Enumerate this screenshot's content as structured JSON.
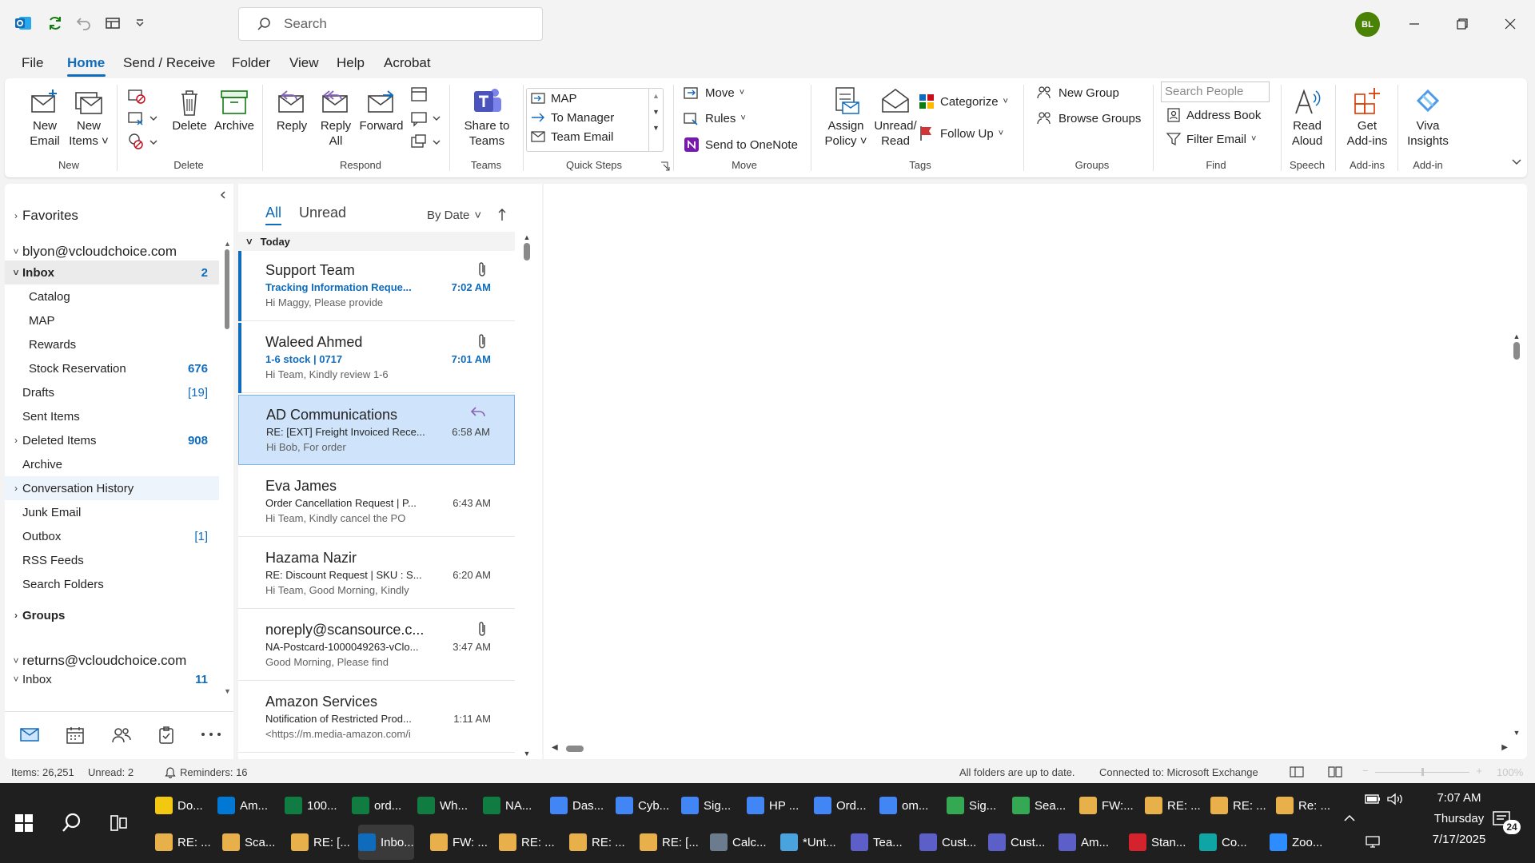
{
  "titlebar": {
    "search_placeholder": "Search",
    "avatar_initials": "BL"
  },
  "menu": [
    "File",
    "Home",
    "Send / Receive",
    "Folder",
    "View",
    "Help",
    "Acrobat"
  ],
  "ribbon": {
    "new_email": [
      "New",
      "Email"
    ],
    "new_items": [
      "New",
      "Items"
    ],
    "delete": "Delete",
    "archive": "Archive",
    "reply": "Reply",
    "reply_all": [
      "Reply",
      "All"
    ],
    "forward": "Forward",
    "share_to_teams": [
      "Share to",
      "Teams"
    ],
    "quick_steps": [
      "MAP",
      "To Manager",
      "Team Email"
    ],
    "move": "Move",
    "rules": "Rules",
    "send_to_onenote": "Send to OneNote",
    "assign_policy": [
      "Assign",
      "Policy"
    ],
    "unread_read": [
      "Unread/",
      "Read"
    ],
    "categorize": "Categorize",
    "follow_up": "Follow Up",
    "new_group": "New Group",
    "browse_groups": "Browse Groups",
    "search_people_placeholder": "Search People",
    "address_book": "Address Book",
    "filter_email": "Filter Email",
    "read_aloud": [
      "Read",
      "Aloud"
    ],
    "get_addins": [
      "Get",
      "Add-ins"
    ],
    "viva_insights": [
      "Viva",
      "Insights"
    ],
    "groups": [
      "New",
      "Delete",
      "Respond",
      "Teams",
      "Quick Steps",
      "Move",
      "Tags",
      "Groups",
      "Find",
      "Speech",
      "Add-ins",
      "Add-in"
    ]
  },
  "folders": {
    "favorites": "Favorites",
    "account1": "blyon@vcloudchoice.com",
    "items": [
      {
        "name": "Inbox",
        "count": "2"
      },
      {
        "name": "Catalog",
        "count": ""
      },
      {
        "name": "MAP",
        "count": ""
      },
      {
        "name": "Rewards",
        "count": ""
      },
      {
        "name": "Stock Reservation",
        "count": "676"
      },
      {
        "name": "Drafts",
        "count": "[19]"
      },
      {
        "name": "Sent Items",
        "count": ""
      },
      {
        "name": "Deleted Items",
        "count": "908"
      },
      {
        "name": "Archive",
        "count": ""
      },
      {
        "name": "Conversation History",
        "count": ""
      },
      {
        "name": "Junk Email",
        "count": ""
      },
      {
        "name": "Outbox",
        "count": "[1]"
      },
      {
        "name": "RSS Feeds",
        "count": ""
      },
      {
        "name": "Search Folders",
        "count": ""
      }
    ],
    "groups": "Groups",
    "account2": "returns@vcloudchoice.com",
    "inbox2": "Inbox",
    "inbox2_count": "11"
  },
  "list": {
    "tab_all": "All",
    "tab_unread": "Unread",
    "sort": "By Date",
    "section": "Today",
    "messages": [
      {
        "sender": "Support Team",
        "subject": "Tracking Information Reque...",
        "preview": "Hi Maggy,  Please provide",
        "time": "7:02 AM"
      },
      {
        "sender": "Waleed Ahmed",
        "subject": "1-6 stock | 0717",
        "preview": "Hi Team,  Kindly review 1-6",
        "time": "7:01 AM"
      },
      {
        "sender": "AD Communications",
        "subject": "RE: [EXT] Freight Invoiced Rece...",
        "preview": "Hi Bob,    For order",
        "time": "6:58 AM"
      },
      {
        "sender": "Eva James",
        "subject": "Order Cancellation Request | P...",
        "preview": "Hi Team,    Kindly cancel the PO",
        "time": "6:43 AM"
      },
      {
        "sender": "Hazama Nazir",
        "subject": "RE: Discount Request | SKU : S...",
        "preview": "Hi Team,  Good Morning, Kindly",
        "time": "6:20 AM"
      },
      {
        "sender": "noreply@scansource.c...",
        "subject": "NA-Postcard-1000049263-vClo...",
        "preview": "Good Morning, Please find",
        "time": "3:47 AM"
      },
      {
        "sender": "Amazon Services",
        "subject": "Notification of Restricted Prod...",
        "preview": "<https://m.media-amazon.com/i",
        "time": "1:11 AM"
      }
    ]
  },
  "status": {
    "items": "Items: 26,251",
    "unread": "Unread: 2",
    "reminders": "Reminders: 16",
    "sync": "All folders are up to date.",
    "connected": "Connected to: Microsoft Exchange",
    "zoom": "100%"
  },
  "taskbar": {
    "row1": [
      "Do...",
      "Am...",
      "100...",
      "ord...",
      "Wh...",
      "NA...",
      "Das...",
      "Cyb...",
      "Sig...",
      "HP ...",
      "Ord...",
      "om...",
      "Sig...",
      "Sea...",
      "FW:...",
      "RE: ...",
      "RE: ...",
      "Re: ..."
    ],
    "row2": [
      "RE: ...",
      "Sca...",
      "RE: [...",
      "Inbo...",
      "FW: ...",
      "RE: ...",
      "RE: ...",
      "RE: [...",
      "Calc...",
      "*Unt...",
      "Tea...",
      "Cust...",
      "Cust...",
      "Am...",
      "Stan...",
      "Co...",
      "Zoo..."
    ],
    "time": "7:07 AM",
    "day": "Thursday",
    "date": "7/17/2025",
    "notif_count": "24"
  },
  "colors": {
    "accent": "#0f6cbd",
    "avatar": "#498205",
    "selected": "#cfe4fa"
  }
}
